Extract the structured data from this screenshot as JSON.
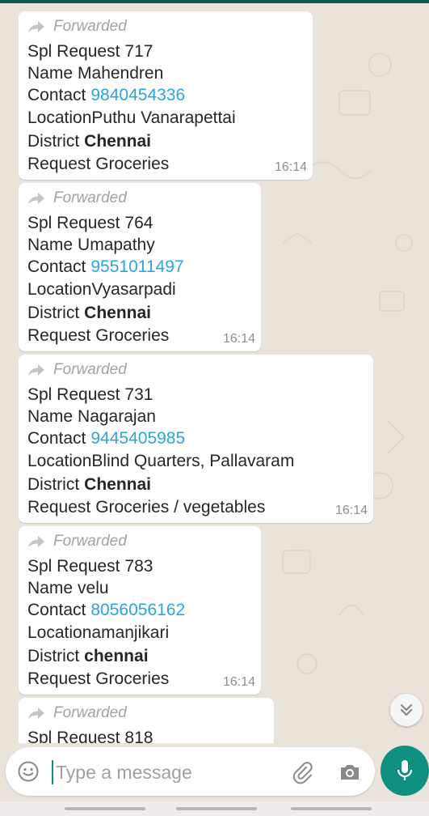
{
  "messages": [
    {
      "forwarded": "Forwarded",
      "spl_key": "Spl Request",
      "spl_val": "717",
      "name_key": "Name",
      "name_val": "Mahendren",
      "contact_key": "Contact",
      "contact_val": "9840454336",
      "location_key": "Location",
      "location_val": "Puthu Vanarapettai",
      "district_key": "District",
      "district_val": "Chennai",
      "request_key": "Request",
      "request_val": "Groceries",
      "time": "16:14"
    },
    {
      "forwarded": "Forwarded",
      "spl_key": "Spl Request",
      "spl_val": "764",
      "name_key": "Name",
      "name_val": "Umapathy",
      "contact_key": "Contact",
      "contact_val": "9551011497",
      "location_key": "Location",
      "location_val": "Vyasarpadi",
      "district_key": "District",
      "district_val": "Chennai",
      "request_key": "Request",
      "request_val": "Groceries",
      "time": "16:14"
    },
    {
      "forwarded": "Forwarded",
      "spl_key": "Spl Request",
      "spl_val": "731",
      "name_key": "Name",
      "name_val": "Nagarajan",
      "contact_key": "Contact",
      "contact_val": "9445405985",
      "location_key": "Location",
      "location_val": "Blind Quarters, Pallavaram",
      "district_key": "District",
      "district_val": "Chennai",
      "request_key": "Request",
      "request_val": "Groceries / vegetables",
      "time": "16:14"
    },
    {
      "forwarded": "Forwarded",
      "spl_key": "Spl Request",
      "spl_val": "783",
      "name_key": "Name",
      "name_val": "velu",
      "contact_key": "Contact",
      "contact_val": "8056056162",
      "location_key": "Location",
      "location_val": "amanjikari",
      "district_key": "District",
      "district_val": "chennai",
      "request_key": "Request",
      "request_val": "Groceries",
      "time": "16:14"
    },
    {
      "forwarded": "Forwarded",
      "spl_key": "Spl Request",
      "spl_val": "818"
    }
  ],
  "composer": {
    "placeholder": "Type a message",
    "value": "",
    "emoji_icon": "emoji-icon",
    "attach_icon": "paperclip-icon",
    "camera_icon": "camera-icon",
    "mic_icon": "microphone-icon"
  },
  "scroll_icon": "double-chevron-down-icon",
  "colors": {
    "header": "#0b5e54",
    "wallpaper": "#e9e3da",
    "bubble": "#ffffff",
    "link": "#2aa5dd",
    "accent": "#0f8f80"
  }
}
